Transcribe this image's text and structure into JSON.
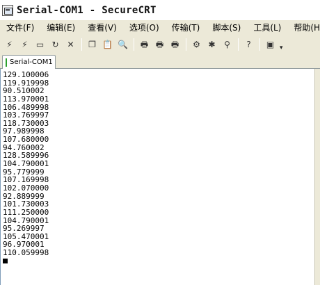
{
  "window": {
    "title": "Serial-COM1 - SecureCRT"
  },
  "menu": [
    {
      "label": "文件(F)"
    },
    {
      "label": "编辑(E)"
    },
    {
      "label": "查看(V)"
    },
    {
      "label": "选项(O)"
    },
    {
      "label": "传输(T)"
    },
    {
      "label": "脚本(S)"
    },
    {
      "label": "工具(L)"
    },
    {
      "label": "帮助(H)"
    }
  ],
  "toolbar": {
    "buttons": [
      {
        "icon": "connect-icon",
        "glyph": "⚡"
      },
      {
        "icon": "quick-connect-icon",
        "glyph": "⚡"
      },
      {
        "icon": "connect-in-tab-icon",
        "glyph": "▭"
      },
      {
        "icon": "reconnect-icon",
        "glyph": "↻"
      },
      {
        "icon": "disconnect-icon",
        "glyph": "✕"
      },
      {
        "icon": "copy-icon",
        "glyph": "❐"
      },
      {
        "icon": "paste-icon",
        "glyph": "📋"
      },
      {
        "icon": "find-icon",
        "glyph": "🔍"
      },
      {
        "icon": "print-icon",
        "glyph": "🖶"
      },
      {
        "icon": "print-selection-icon",
        "glyph": "🖶"
      },
      {
        "icon": "print-screen-icon",
        "glyph": "🖶"
      },
      {
        "icon": "session-options-icon",
        "glyph": "⚙"
      },
      {
        "icon": "global-options-icon",
        "glyph": "✱"
      },
      {
        "icon": "keymap-icon",
        "glyph": "⚲"
      },
      {
        "icon": "help-icon",
        "glyph": "?"
      },
      {
        "icon": "screen-icon",
        "glyph": "▣"
      }
    ],
    "more_glyph": "▾"
  },
  "tabs": [
    {
      "label": "Serial-COM1",
      "status_color": "#2ca02c"
    }
  ],
  "terminal": {
    "lines": [
      "129.100006",
      "119.919998",
      "90.510002",
      "113.970001",
      "106.489998",
      "103.769997",
      "118.730003",
      "97.989998",
      "107.680000",
      "94.760002",
      "128.589996",
      "104.790001",
      "95.779999",
      "107.169998",
      "102.070000",
      "92.889999",
      "101.730003",
      "111.250000",
      "104.790001",
      "95.269997",
      "105.470001",
      "96.970001",
      "110.059998"
    ]
  }
}
